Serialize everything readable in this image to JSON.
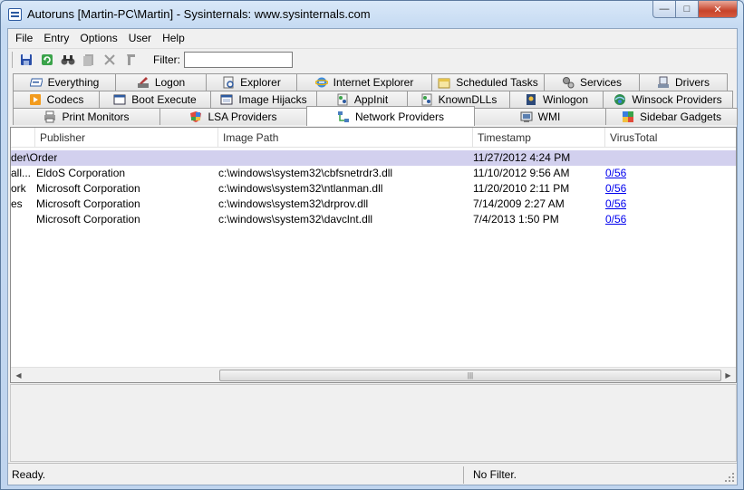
{
  "window": {
    "title": "Autoruns [Martin-PC\\Martin] - Sysinternals: www.sysinternals.com"
  },
  "menu": [
    "File",
    "Entry",
    "Options",
    "User",
    "Help"
  ],
  "toolbar": {
    "buttons": [
      "save-icon",
      "refresh-icon",
      "find-icon",
      "copy-icon",
      "delete-icon",
      "jump-icon"
    ],
    "filter_label": "Filter:",
    "filter_value": ""
  },
  "tabs": {
    "row1": [
      "Everything",
      "Logon",
      "Explorer",
      "Internet Explorer",
      "Scheduled Tasks",
      "Services",
      "Drivers"
    ],
    "row2": [
      "Codecs",
      "Boot Execute",
      "Image Hijacks",
      "AppInit",
      "KnownDLLs",
      "Winlogon",
      "Winsock Providers"
    ],
    "row3": [
      "Print Monitors",
      "LSA Providers",
      "Network Providers",
      "WMI",
      "Sidebar Gadgets"
    ],
    "active": "Network Providers"
  },
  "columns": [
    "Publisher",
    "Image Path",
    "Timestamp",
    "VirusTotal"
  ],
  "group_row": {
    "entry": "der\\Order",
    "timestamp": "11/27/2012 4:24 PM"
  },
  "rows": [
    {
      "entry": "all...",
      "publisher": "EldoS Corporation",
      "path": "c:\\windows\\system32\\cbfsnetrdr3.dll",
      "timestamp": "11/10/2012 9:56 AM",
      "vt": "0/56"
    },
    {
      "entry": "ork",
      "publisher": "Microsoft Corporation",
      "path": "c:\\windows\\system32\\ntlanman.dll",
      "timestamp": "11/20/2010 2:11 PM",
      "vt": "0/56"
    },
    {
      "entry": "es",
      "publisher": "Microsoft Corporation",
      "path": "c:\\windows\\system32\\drprov.dll",
      "timestamp": "7/14/2009 2:27 AM",
      "vt": "0/56"
    },
    {
      "entry": "",
      "publisher": "Microsoft Corporation",
      "path": "c:\\windows\\system32\\davclnt.dll",
      "timestamp": "7/4/2013 1:50 PM",
      "vt": "0/56"
    }
  ],
  "status": {
    "left": "Ready.",
    "right": "No Filter."
  }
}
